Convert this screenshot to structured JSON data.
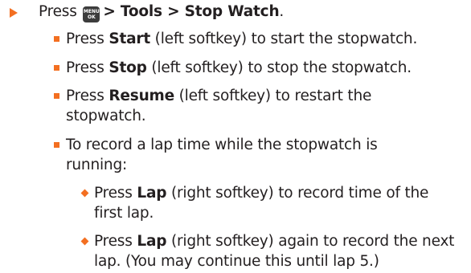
{
  "step": {
    "press": "Press",
    "key_top": "MENU",
    "key_bottom": "OK",
    "path": "> Tools > Stop Watch",
    "period": "."
  },
  "items": [
    {
      "pre": "Press ",
      "bold": "Start",
      "post": " (left softkey) to start the stopwatch."
    },
    {
      "pre": "Press ",
      "bold": "Stop",
      "post": " (left softkey) to stop the stopwatch."
    },
    {
      "pre": "Press ",
      "bold": "Resume",
      "post": " (left softkey) to restart the",
      "cont": "stopwatch."
    },
    {
      "text": "To record a lap time while the stopwatch is",
      "cont": "running:"
    }
  ],
  "subitems": [
    {
      "pre": "Press ",
      "bold": "Lap",
      "post": " (right softkey) to record time of the",
      "cont": "first lap."
    },
    {
      "pre": "Press ",
      "bold": "Lap",
      "post": " (right softkey) again to record the next",
      "cont": "lap. (You may continue this until lap 5.)"
    }
  ],
  "colors": {
    "accent": "#f36f21",
    "text": "#231f20",
    "key": "#3c3c3c"
  }
}
